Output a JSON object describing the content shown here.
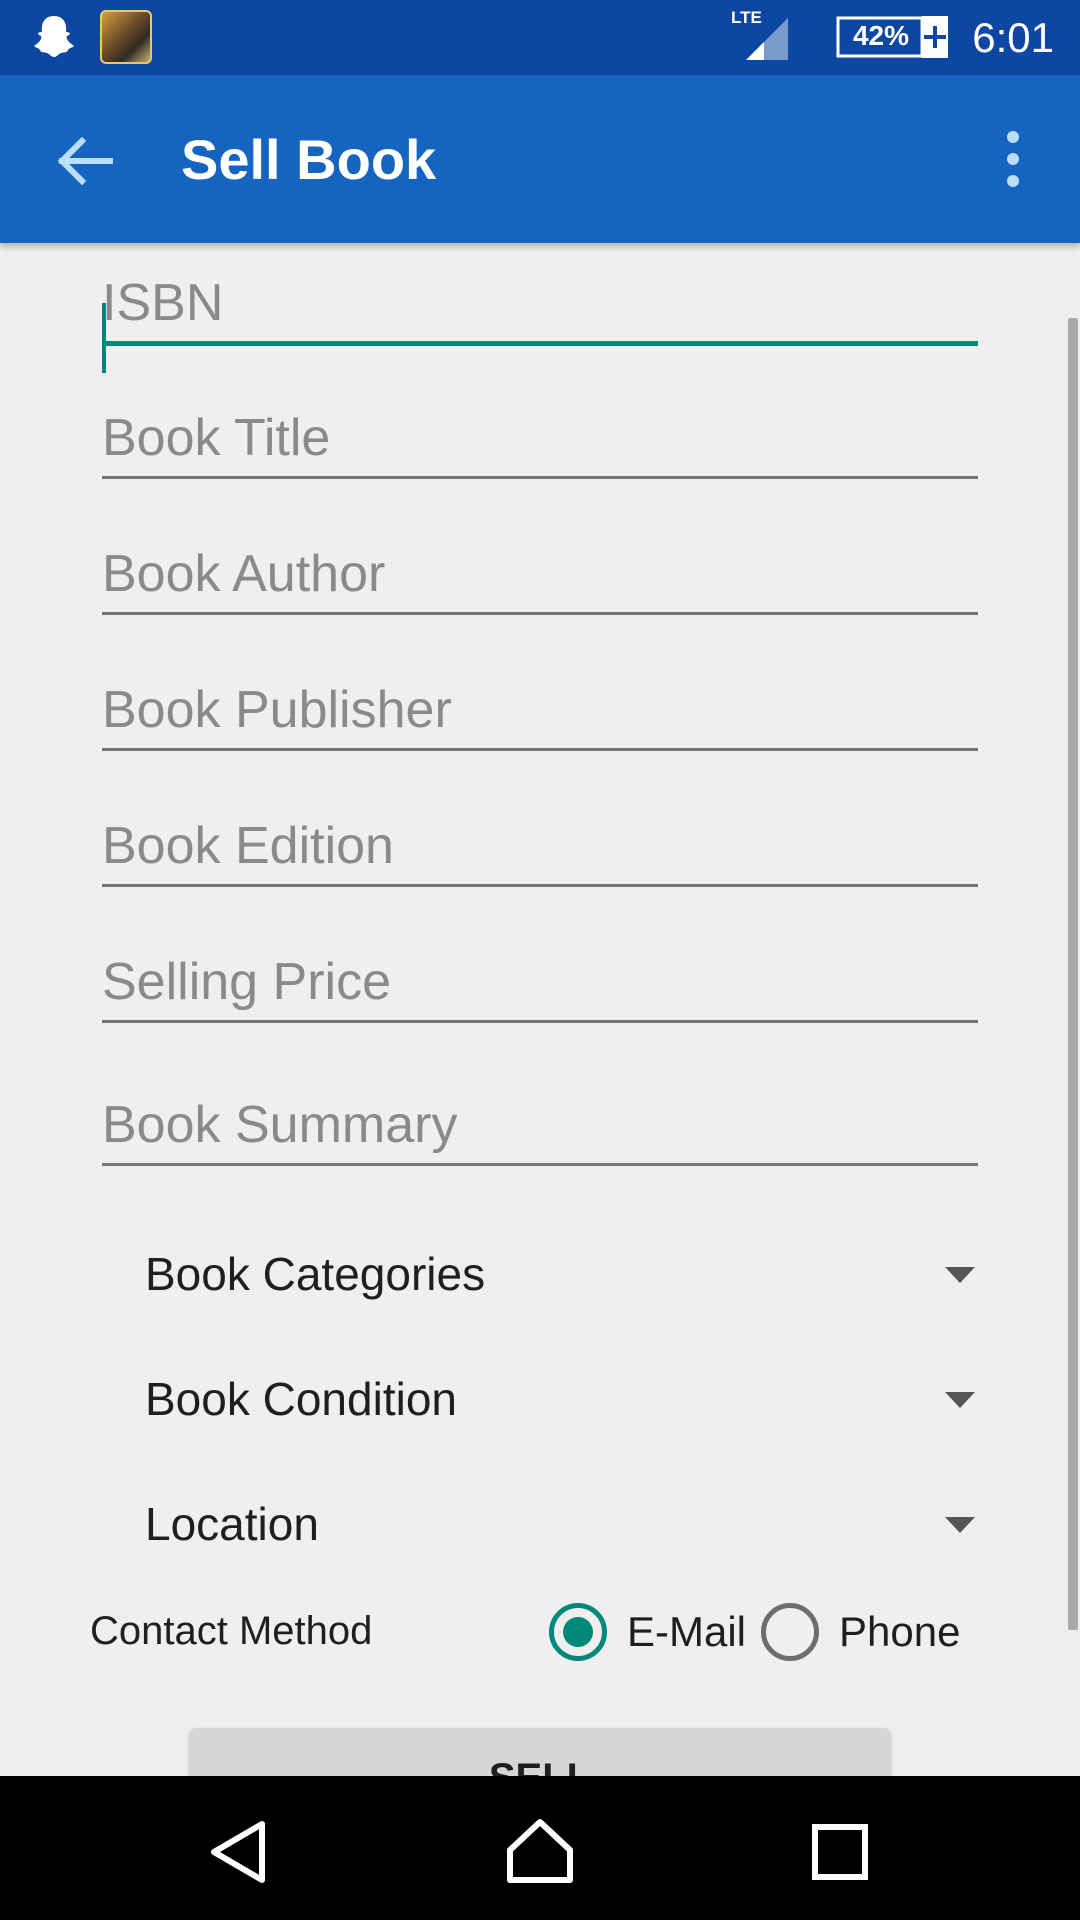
{
  "status_bar": {
    "network": "LTE",
    "battery": "42%",
    "time": "6:01",
    "icons": [
      "snapchat-ghost-icon",
      "game-app-icon",
      "signal-icon",
      "battery-charging-icon"
    ]
  },
  "app_bar": {
    "title": "Sell Book",
    "back_icon": "arrow-back-icon",
    "menu_icon": "overflow-menu-icon"
  },
  "form": {
    "fields": [
      {
        "placeholder": "ISBN",
        "value": "",
        "focused": true
      },
      {
        "placeholder": "Book Title",
        "value": ""
      },
      {
        "placeholder": "Book Author",
        "value": ""
      },
      {
        "placeholder": "Book Publisher",
        "value": ""
      },
      {
        "placeholder": "Book Edition",
        "value": ""
      },
      {
        "placeholder": "Selling Price",
        "value": ""
      },
      {
        "placeholder": "Book Summary",
        "value": ""
      }
    ],
    "spinners": [
      {
        "label": "Book Categories"
      },
      {
        "label": "Book Condition"
      },
      {
        "label": "Location"
      }
    ],
    "contact": {
      "label": "Contact Method",
      "options": [
        {
          "label": "E-Mail",
          "checked": true
        },
        {
          "label": "Phone",
          "checked": false
        }
      ]
    },
    "submit_label": "SELL"
  },
  "colors": {
    "status_bar": "#0d47a1",
    "app_bar": "#1565c0",
    "accent": "#00897b",
    "background": "#efefef"
  },
  "nav_bar": {
    "icons": [
      "back-triangle-icon",
      "home-icon",
      "recents-icon"
    ]
  }
}
